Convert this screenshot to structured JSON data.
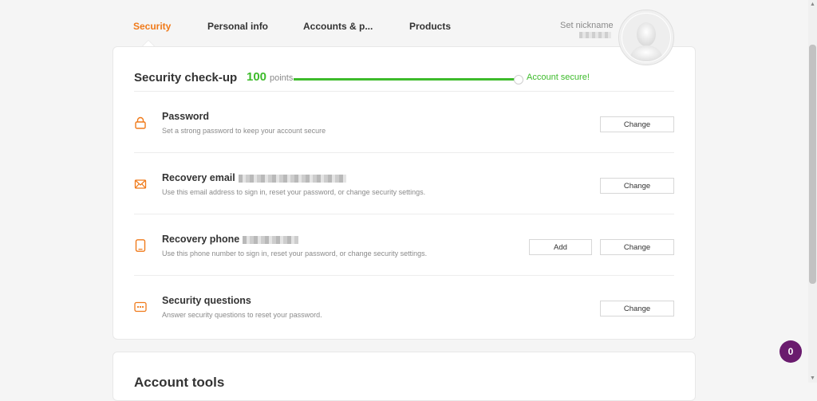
{
  "nav": {
    "tabs": [
      {
        "label": "Security",
        "active": true
      },
      {
        "label": "Personal info"
      },
      {
        "label": "Accounts & p..."
      },
      {
        "label": "Products"
      }
    ],
    "nickname_link": "Set nickname"
  },
  "checkup": {
    "title": "Security check-up",
    "score": "100",
    "points_label": "points",
    "progress_percent": 100,
    "status": "Account secure!",
    "status_color": "#3dbb2b"
  },
  "items": [
    {
      "title": "Password",
      "desc": "Set a strong password to keep your account secure",
      "icon": "lock-icon",
      "buttons": [
        "Change"
      ]
    },
    {
      "title": "Recovery email",
      "desc": "Use this email address to sign in, reset your password, or change security settings.",
      "icon": "envelope-icon",
      "buttons": [
        "Change"
      ]
    },
    {
      "title": "Recovery phone",
      "desc": "Use this phone number to sign in, reset your password, or change security settings.",
      "icon": "phone-icon",
      "buttons": [
        "Add",
        "Change"
      ]
    },
    {
      "title": "Security questions",
      "desc": "Answer security questions to reset your password.",
      "icon": "dots-icon",
      "buttons": [
        "Change"
      ]
    }
  ],
  "tools": {
    "title": "Account tools"
  },
  "badge": {
    "count": "0",
    "color": "#6a1b6e"
  },
  "accent_color": "#f07a1a"
}
